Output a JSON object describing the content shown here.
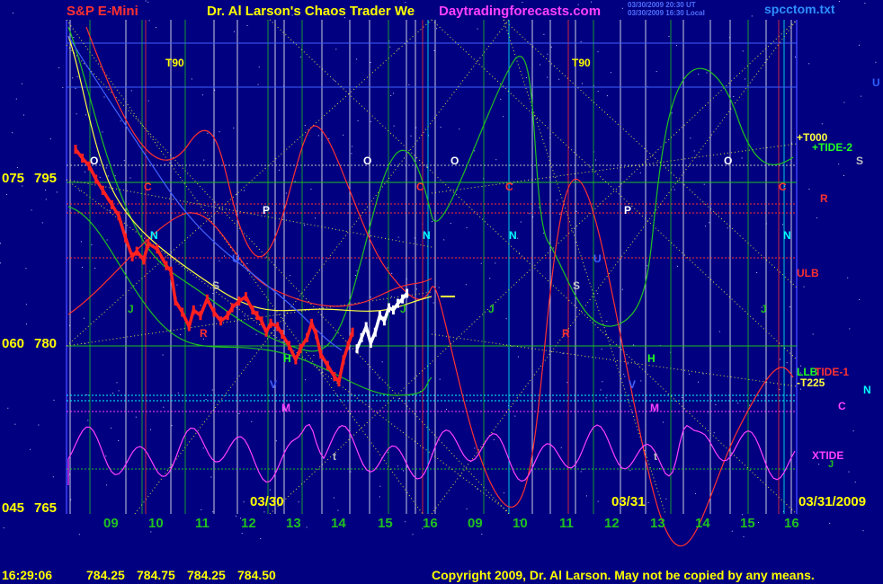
{
  "header": {
    "symbol": "S&P E-Mini",
    "title": "Dr. Al Larson's Chaos Trader We",
    "site": "Daytradingforecasts.com",
    "stamp1": "03/30/2009 20:30 UT",
    "stamp2": "03/30/2009 16:30 Local",
    "file": "spcctom.txt"
  },
  "footer": {
    "time": "16:29:06",
    "prices": [
      "784.25",
      "784.75",
      "784.25",
      "784.50"
    ],
    "copyright": "Copyright 2009, Dr. Al Larson. May not be copied by any means."
  },
  "colors": {
    "background": "#000080",
    "price": "#ff2020",
    "price_today": "#ffffff",
    "text_yellow": "#ffff00",
    "text_red": "#ff3030",
    "grid_green": "#20c020",
    "grid_white": "#e0e0e0",
    "cyan": "#00ffff",
    "magenta": "#ff40ff"
  },
  "chart_data": {
    "type": "line",
    "y_axis": {
      "ticks": [
        {
          "alt": "075",
          "value": 795
        },
        {
          "alt": "060",
          "value": 780
        },
        {
          "alt": "045",
          "value": 765
        }
      ],
      "ylim": [
        765,
        811
      ]
    },
    "x_axis": {
      "hour_labels": [
        "09",
        "10",
        "11",
        "12",
        "13",
        "14",
        "15",
        "16",
        "09",
        "10",
        "11",
        "12",
        "13",
        "14",
        "15",
        "16"
      ],
      "dates": [
        "03/30",
        "03/31",
        "03/31/2009"
      ]
    },
    "series": [
      {
        "name": "",
        "values": [
          [
            0.0,
            797.5
          ],
          [
            0.15,
            796.7
          ],
          [
            0.3,
            796.0
          ],
          [
            0.45,
            794.8
          ],
          [
            0.6,
            793.8
          ],
          [
            0.8,
            792.5
          ],
          [
            0.95,
            791.5
          ],
          [
            1.1,
            789.5
          ],
          [
            1.25,
            787.8
          ],
          [
            1.35,
            788.3
          ],
          [
            1.5,
            787.5
          ],
          [
            1.6,
            789.0
          ],
          [
            1.8,
            788.5
          ],
          [
            2.0,
            787.0
          ],
          [
            2.1,
            786.5
          ],
          [
            2.2,
            783.8
          ],
          [
            2.35,
            782.8
          ],
          [
            2.5,
            781.5
          ],
          [
            2.6,
            783.0
          ],
          [
            2.75,
            782.5
          ],
          [
            2.9,
            784.0
          ],
          [
            3.05,
            782.8
          ],
          [
            3.2,
            782.0
          ],
          [
            3.35,
            782.5
          ],
          [
            3.45,
            783.2
          ],
          [
            3.6,
            783.8
          ],
          [
            3.75,
            784.2
          ],
          [
            3.9,
            783.0
          ],
          [
            4.0,
            782.5
          ],
          [
            4.1,
            782.0
          ],
          [
            4.2,
            781.0
          ],
          [
            4.3,
            781.8
          ],
          [
            4.45,
            781.5
          ],
          [
            4.55,
            780.8
          ],
          [
            4.7,
            779.8
          ],
          [
            4.85,
            778.5
          ],
          [
            4.95,
            779.5
          ],
          [
            5.1,
            780.5
          ],
          [
            5.2,
            781.8
          ],
          [
            5.3,
            780.8
          ],
          [
            5.4,
            779.0
          ],
          [
            5.55,
            778.0
          ],
          [
            5.7,
            777.0
          ],
          [
            5.8,
            776.5
          ],
          [
            5.9,
            778.5
          ],
          [
            6.0,
            779.8
          ],
          [
            6.1,
            781.0
          ]
        ]
      },
      {
        "name": "",
        "values": [
          [
            6.2,
            779.5
          ],
          [
            6.3,
            780.5
          ],
          [
            6.4,
            781.5
          ],
          [
            6.5,
            780.0
          ],
          [
            6.6,
            781.0
          ],
          [
            6.7,
            782.5
          ],
          [
            6.8,
            782.0
          ],
          [
            6.9,
            783.2
          ],
          [
            7.0,
            783.0
          ],
          [
            7.1,
            783.6
          ],
          [
            7.2,
            784.0
          ],
          [
            7.3,
            784.5
          ]
        ]
      }
    ],
    "labels": {
      "planets": [
        "O",
        "C",
        "P",
        "N",
        "U",
        "J",
        "S",
        "R",
        "H",
        "V",
        "M",
        "t"
      ],
      "right_side": [
        "U",
        "+T000",
        "+TIDE-2",
        "S",
        "R",
        "ULB",
        "LLB",
        "TIDE-1",
        "-T225",
        "N",
        "C",
        "XTIDE",
        "J"
      ],
      "top": [
        "T90",
        "T90"
      ]
    }
  }
}
